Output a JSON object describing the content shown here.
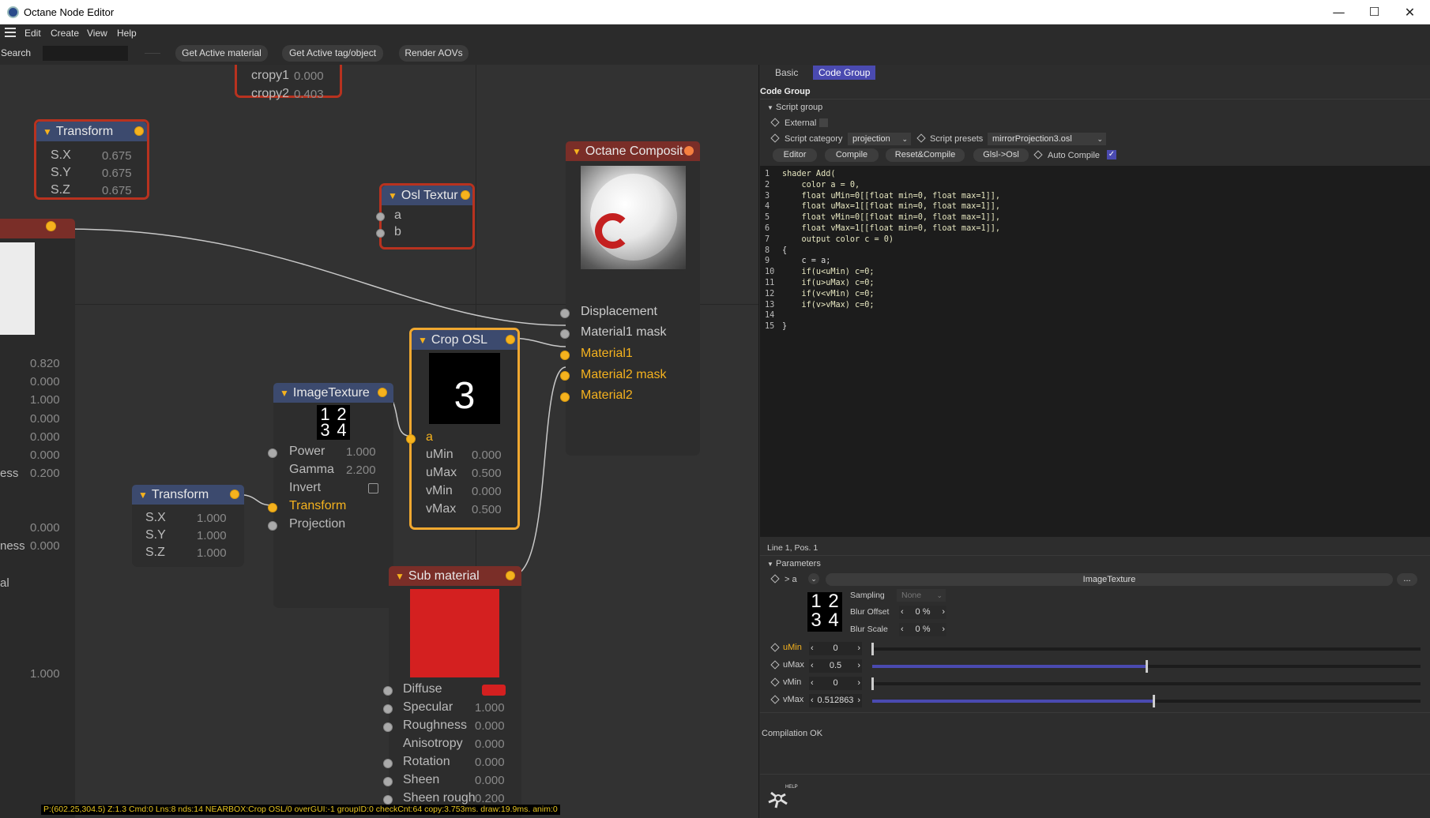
{
  "window": {
    "title": "Octane Node Editor",
    "minimize": "—",
    "maximize": "☐",
    "close": "✕"
  },
  "menu": [
    "Edit",
    "Create",
    "View",
    "Help"
  ],
  "toolbar": {
    "search_label": "Search",
    "search_value": "",
    "buttons": [
      "Get Active material",
      "Get Active tag/object",
      "Render AOVs"
    ]
  },
  "canvas": {
    "crop_top": {
      "rows": [
        {
          "label": "cropy1",
          "value": "0.000"
        },
        {
          "label": "cropy2",
          "value": "0.403"
        }
      ]
    },
    "transform1": {
      "title": "Transform",
      "rows": [
        {
          "label": "S.X",
          "value": "0.675"
        },
        {
          "label": "S.Y",
          "value": "0.675"
        },
        {
          "label": "S.Z",
          "value": "0.675"
        }
      ]
    },
    "osl_texture": {
      "title": "Osl Textur",
      "inputs": [
        "a",
        "b"
      ]
    },
    "composite": {
      "title": "Octane Composit",
      "inputs": [
        "Displacement",
        "Material1 mask",
        "Material1",
        "Material2 mask",
        "Material2"
      ]
    },
    "crop_osl": {
      "title": "Crop OSL",
      "preview_text": "3",
      "input": "a",
      "rows": [
        {
          "label": "uMin",
          "value": "0.000"
        },
        {
          "label": "uMax",
          "value": "0.500"
        },
        {
          "label": "vMin",
          "value": "0.000"
        },
        {
          "label": "vMax",
          "value": "0.500"
        }
      ]
    },
    "image_texture": {
      "title": "ImageTexture",
      "preview_text": [
        "1",
        "2",
        "3",
        "4"
      ],
      "rows": [
        {
          "label": "Power",
          "value": "1.000"
        },
        {
          "label": "Gamma",
          "value": "2.200"
        },
        {
          "label": "Invert",
          "value": ""
        },
        {
          "label": "Transform",
          "value": ""
        },
        {
          "label": "Projection",
          "value": ""
        }
      ]
    },
    "transform2": {
      "title": "Transform",
      "rows": [
        {
          "label": "S.X",
          "value": "1.000"
        },
        {
          "label": "S.Y",
          "value": "1.000"
        },
        {
          "label": "S.Z",
          "value": "1.000"
        }
      ]
    },
    "sub_material": {
      "title": "Sub material",
      "swatch_color": "#d42020",
      "rows": [
        {
          "label": "Diffuse",
          "value": ""
        },
        {
          "label": "Specular",
          "value": "1.000"
        },
        {
          "label": "Roughness",
          "value": "0.000"
        },
        {
          "label": "Anisotropy",
          "value": "0.000"
        },
        {
          "label": "Rotation",
          "value": "0.000"
        },
        {
          "label": "Sheen",
          "value": "0.000"
        },
        {
          "label": "Sheen rough",
          "value": "0.200"
        }
      ]
    },
    "left_values": [
      "0.820",
      "0.000",
      "1.000",
      "0.000",
      "0.000",
      "0.000",
      "0.200",
      "0.000",
      "0.000",
      "1.000"
    ],
    "left_labels": [
      "ess",
      "ness",
      "al"
    ],
    "status": "P:(602.25,304.5) Z:1.3 Cmd:0 Lns:8 nds:14 NEARBOX:Crop OSL/0 overGUI:-1 groupID:0 checkCnt:64 copy:3.753ms. draw:19.9ms. anim:0"
  },
  "panel": {
    "tabs": [
      "Basic",
      "Code Group"
    ],
    "heading": "Code Group",
    "script_group": "Script group",
    "external_label": "External",
    "script_category_label": "Script category",
    "script_category_value": "projection",
    "script_presets_label": "Script presets",
    "script_presets_value": "mirrorProjection3.osl",
    "buttons": [
      "Editor",
      "Compile",
      "Reset&Compile",
      "Glsl->Osl"
    ],
    "auto_compile_label": "Auto Compile",
    "code_lines": [
      "shader Add(",
      "    color a = 0,",
      "    float uMin=0[[float min=0, float max=1]],",
      "    float uMax=1[[float min=0, float max=1]],",
      "    float vMin=0[[float min=0, float max=1]],",
      "    float vMax=1[[float min=0, float max=1]],",
      "    output color c = 0)",
      "{",
      "    c = a;",
      "    if(u<uMin) c=0;",
      "    if(u>uMax) c=0;",
      "    if(v<vMin) c=0;",
      "    if(v>vMax) c=0;",
      "",
      "}"
    ],
    "cursor_pos": "Line 1, Pos. 1",
    "parameters_label": "Parameters",
    "param_a_label": "a",
    "param_a_value": "ImageTexture",
    "more_button": "...",
    "preview_digits": [
      "1",
      "2",
      "3",
      "4"
    ],
    "sampling_label": "Sampling",
    "sampling_value": "None",
    "blur_offset_label": "Blur Offset",
    "blur_offset_value": "0 %",
    "blur_scale_label": "Blur Scale",
    "blur_scale_value": "0 %",
    "sliders": [
      {
        "label": "uMin",
        "value": "0",
        "fraction": 0.0
      },
      {
        "label": "uMax",
        "value": "0.5",
        "fraction": 0.5
      },
      {
        "label": "vMin",
        "value": "0",
        "fraction": 0.0
      },
      {
        "label": "vMax",
        "value": "0.512863",
        "fraction": 0.512863
      }
    ],
    "compile_status": "Compilation OK",
    "help_label": "HELP"
  },
  "colors": {
    "accent": "#f5b21e",
    "node_header_blue": "#3c4a6e",
    "node_header_red": "#7a2e28",
    "selected_red": "#b8321f",
    "selected_orange": "#f0a830",
    "tab_active": "#4a4ab0"
  }
}
